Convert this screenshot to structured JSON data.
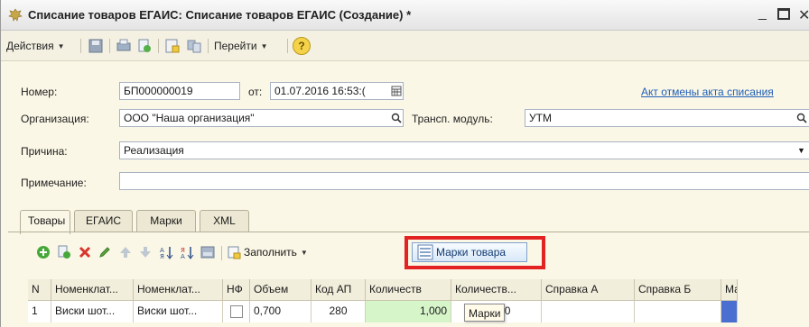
{
  "window": {
    "title": "Списание товаров ЕГАИС: Списание товаров ЕГАИС (Создание) *",
    "minimize_label": "_"
  },
  "toolbar": {
    "actions_label": "Действия",
    "goto_label": "Перейти",
    "help_label": "?"
  },
  "form": {
    "number_label": "Номер:",
    "number_value": "БП000000019",
    "date_label": "от:",
    "date_value": "01.07.2016 16:53:(",
    "cancel_act_link": "Акт отмены акта списания",
    "org_label": "Организация:",
    "org_value": "ООО \"Наша организация\"",
    "transport_label": "Трансп. модуль:",
    "transport_value": "УТМ",
    "reason_label": "Причина:",
    "reason_value": "Реализация",
    "note_label": "Примечание:",
    "note_value": ""
  },
  "tabs": [
    "Товары",
    "ЕГАИС",
    "Марки",
    "XML"
  ],
  "panel_toolbar": {
    "fill_label": "Заполнить",
    "marks_button_label": "Марки товара"
  },
  "grid": {
    "headers": [
      "N",
      "Номенклат...",
      "Номенклат...",
      "НФ",
      "Объем",
      "Код АП",
      "Количеств",
      "Количеств...",
      "Справка А",
      "Справка Б",
      "Марк"
    ],
    "rows": [
      [
        "1",
        "Виски шот...",
        "Виски шот...",
        "",
        "0,700",
        "280",
        "1,000",
        "0,07000",
        "",
        "",
        ""
      ]
    ]
  },
  "tooltip": "Марки",
  "colors": {
    "highlight": "#e32222",
    "quantity_cell": "#d6f5c9",
    "selected_cell": "#4a6fd1"
  }
}
